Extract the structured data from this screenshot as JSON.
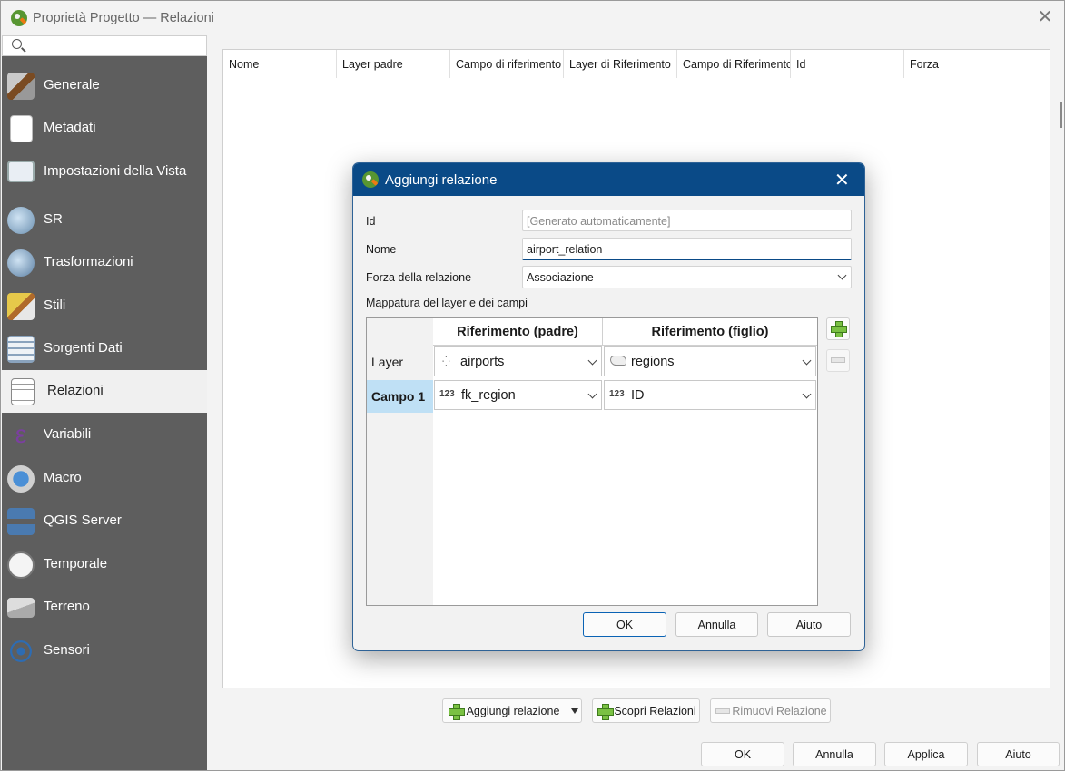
{
  "window": {
    "title": "Proprietà Progetto — Relazioni"
  },
  "sidebar": {
    "search_placeholder": "",
    "items": [
      {
        "label": "Generale",
        "icon": "tools-icon"
      },
      {
        "label": "Metadati",
        "icon": "metadata-icon"
      },
      {
        "label": "Impostazioni della Vista",
        "icon": "map-view-icon"
      },
      {
        "label": "SR",
        "icon": "globe-icon"
      },
      {
        "label": "Trasformazioni",
        "icon": "transform-globe-icon"
      },
      {
        "label": "Stili",
        "icon": "paintbrush-icon"
      },
      {
        "label": "Sorgenti Dati",
        "icon": "data-sources-icon"
      },
      {
        "label": "Relazioni",
        "icon": "relations-icon"
      },
      {
        "label": "Variabili",
        "icon": "epsilon-icon"
      },
      {
        "label": "Macro",
        "icon": "macro-icon"
      },
      {
        "label": "QGIS Server",
        "icon": "server-icon"
      },
      {
        "label": "Temporale",
        "icon": "clock-icon"
      },
      {
        "label": "Terreno",
        "icon": "terrain-icon"
      },
      {
        "label": "Sensori",
        "icon": "sensor-icon"
      }
    ]
  },
  "relations_table": {
    "columns": [
      "Nome",
      "Layer padre",
      "Campo di riferimento",
      "Layer di Riferimento",
      "Campo di Riferimento",
      "Id",
      "Forza"
    ]
  },
  "relations_actions": {
    "add": "Aggiungi relazione",
    "discover": "Scopri Relazioni",
    "remove": "Rimuovi Relazione"
  },
  "dialog_buttons": {
    "ok": "OK",
    "cancel": "Annulla",
    "apply": "Applica",
    "help": "Aiuto"
  },
  "add_relation_dialog": {
    "title": "Aggiungi relazione",
    "id_label": "Id",
    "id_placeholder": "[Generato automaticamente]",
    "name_label": "Nome",
    "name_value": "airport_relation",
    "strength_label": "Forza della relazione",
    "strength_value": "Associazione",
    "mapping_label": "Mappatura del layer e dei campi",
    "col_parent": "Riferimento (padre)",
    "col_child": "Riferimento (figlio)",
    "row_layer": "Layer",
    "row_field": "Campo 1",
    "parent_layer": "airports",
    "child_layer": "regions",
    "parent_field_type": "123",
    "parent_field": "fk_region",
    "child_field_type": "123",
    "child_field": "ID",
    "ok": "OK",
    "cancel": "Annulla",
    "help": "Aiuto"
  },
  "colors": {
    "sidebar_bg": "#5e5e5e",
    "dialog_title_bg": "#0a4a87",
    "selected_row": "#bfe0f5"
  }
}
